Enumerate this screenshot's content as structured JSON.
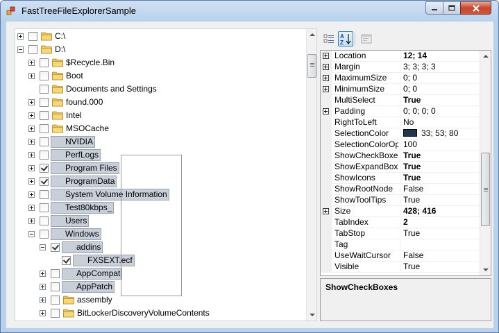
{
  "window": {
    "title": "FastTreeFileExplorerSample",
    "buttons": {
      "minimize": "minimize-icon",
      "maximize": "maximize-icon",
      "close": "close-icon"
    }
  },
  "tree": {
    "nodes": [
      {
        "level": 0,
        "expander": "plus",
        "checked": false,
        "icon": "folder-icon",
        "label": "C:\\",
        "selected": false
      },
      {
        "level": 0,
        "expander": "minus",
        "checked": false,
        "icon": "folder-icon",
        "label": "D:\\",
        "selected": false
      },
      {
        "level": 1,
        "expander": "plus",
        "checked": false,
        "icon": "folder-icon",
        "label": "$Recycle.Bin",
        "selected": false
      },
      {
        "level": 1,
        "expander": "plus",
        "checked": false,
        "icon": "folder-icon",
        "label": "Boot",
        "selected": false
      },
      {
        "level": 1,
        "expander": "none",
        "checked": false,
        "icon": "folder-icon",
        "label": "Documents and Settings",
        "selected": false
      },
      {
        "level": 1,
        "expander": "plus",
        "checked": false,
        "icon": "folder-icon",
        "label": "found.000",
        "selected": false
      },
      {
        "level": 1,
        "expander": "plus",
        "checked": false,
        "icon": "folder-icon",
        "label": "Intel",
        "selected": false
      },
      {
        "level": 1,
        "expander": "plus",
        "checked": false,
        "icon": "folder-icon",
        "label": "MSOCache",
        "selected": false
      },
      {
        "level": 1,
        "expander": "plus",
        "checked": false,
        "icon": "folder-icon",
        "label": "NVIDIA",
        "selected": true
      },
      {
        "level": 1,
        "expander": "plus",
        "checked": false,
        "icon": "folder-icon",
        "label": "PerfLogs",
        "selected": true
      },
      {
        "level": 1,
        "expander": "plus",
        "checked": true,
        "icon": "folder-icon",
        "label": "Program Files",
        "selected": true
      },
      {
        "level": 1,
        "expander": "plus",
        "checked": true,
        "icon": "folder-icon",
        "label": "ProgramData",
        "selected": true
      },
      {
        "level": 1,
        "expander": "plus",
        "checked": false,
        "icon": "folder-icon",
        "label": "System Volume Information",
        "selected": true
      },
      {
        "level": 1,
        "expander": "plus",
        "checked": false,
        "icon": "folder-icon",
        "label": "Test80kbps_",
        "selected": true
      },
      {
        "level": 1,
        "expander": "plus",
        "checked": false,
        "icon": "folder-icon",
        "label": "Users",
        "selected": true
      },
      {
        "level": 1,
        "expander": "minus",
        "checked": false,
        "icon": "folder-icon",
        "label": "Windows",
        "selected": true
      },
      {
        "level": 2,
        "expander": "minus",
        "checked": true,
        "icon": "folder-icon",
        "label": "addins",
        "selected": true
      },
      {
        "level": 3,
        "expander": "none",
        "checked": true,
        "icon": "file-icon",
        "label": "FXSEXT.ecf",
        "selected": true
      },
      {
        "level": 2,
        "expander": "plus",
        "checked": false,
        "icon": "folder-icon",
        "label": "AppCompat",
        "selected": true
      },
      {
        "level": 2,
        "expander": "plus",
        "checked": false,
        "icon": "folder-icon",
        "label": "AppPatch",
        "selected": true
      },
      {
        "level": 2,
        "expander": "plus",
        "checked": false,
        "icon": "folder-icon",
        "label": "assembly",
        "selected": false
      },
      {
        "level": 2,
        "expander": "plus",
        "checked": false,
        "icon": "folder-icon",
        "label": "BitLockerDiscoveryVolumeContents",
        "selected": false
      }
    ],
    "scroll_position": 0.05
  },
  "property_grid": {
    "toolbar": {
      "categorized": "categorized-icon",
      "alphabetical": "alphabetical-sort-icon",
      "property_pages": "property-pages-icon"
    },
    "rows": [
      {
        "name": "Location",
        "value": "12; 14",
        "bold": true,
        "expandable": true
      },
      {
        "name": "Margin",
        "value": "3; 3; 3; 3",
        "bold": false,
        "expandable": true
      },
      {
        "name": "MaximumSize",
        "value": "0; 0",
        "bold": false,
        "expandable": true
      },
      {
        "name": "MinimumSize",
        "value": "0; 0",
        "bold": false,
        "expandable": true
      },
      {
        "name": "MultiSelect",
        "value": "True",
        "bold": true,
        "expandable": false
      },
      {
        "name": "Padding",
        "value": "0; 0; 0; 0",
        "bold": false,
        "expandable": true
      },
      {
        "name": "RightToLeft",
        "value": "No",
        "bold": false,
        "expandable": false
      },
      {
        "name": "SelectionColor",
        "value": "33; 53; 80",
        "bold": false,
        "expandable": false,
        "swatch": "#213550"
      },
      {
        "name": "SelectionColorOpaq",
        "value": "100",
        "bold": false,
        "expandable": false
      },
      {
        "name": "ShowCheckBoxes",
        "value": "True",
        "bold": true,
        "expandable": false
      },
      {
        "name": "ShowExpandBoxes",
        "value": "True",
        "bold": true,
        "expandable": false
      },
      {
        "name": "ShowIcons",
        "value": "True",
        "bold": true,
        "expandable": false
      },
      {
        "name": "ShowRootNode",
        "value": "False",
        "bold": false,
        "expandable": false
      },
      {
        "name": "ShowToolTips",
        "value": "True",
        "bold": false,
        "expandable": false
      },
      {
        "name": "Size",
        "value": "428; 416",
        "bold": true,
        "expandable": true
      },
      {
        "name": "TabIndex",
        "value": "2",
        "bold": true,
        "expandable": false
      },
      {
        "name": "TabStop",
        "value": "True",
        "bold": false,
        "expandable": false
      },
      {
        "name": "Tag",
        "value": "",
        "bold": false,
        "expandable": false
      },
      {
        "name": "UseWaitCursor",
        "value": "False",
        "bold": false,
        "expandable": false
      },
      {
        "name": "Visible",
        "value": "True",
        "bold": false,
        "expandable": false
      }
    ],
    "scroll_position": 0.7,
    "help_title": "ShowCheckBoxes"
  }
}
